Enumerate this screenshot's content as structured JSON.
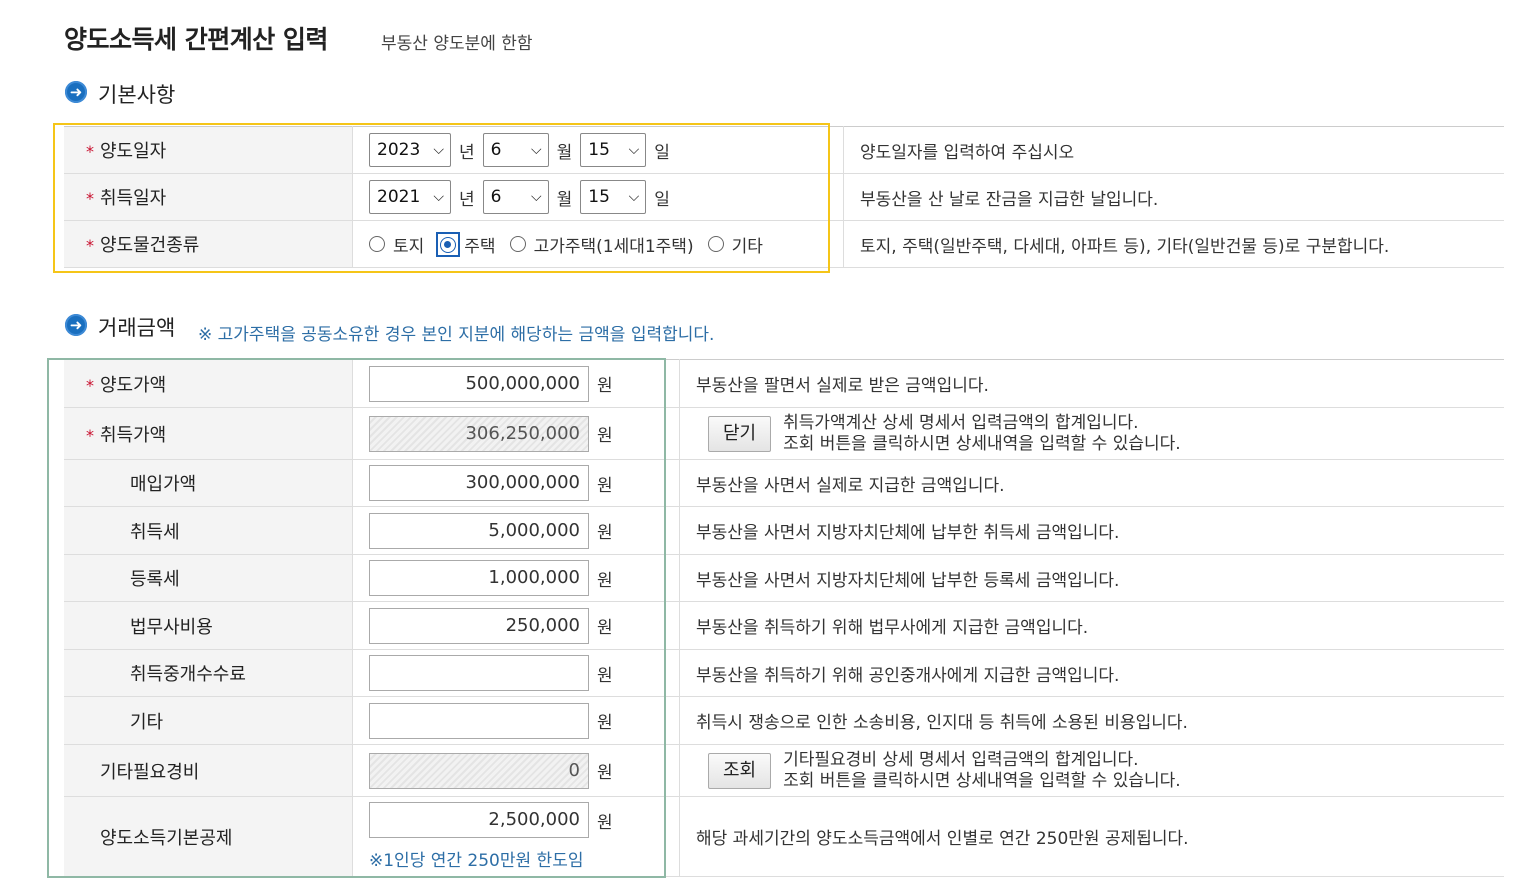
{
  "header": {
    "title": "양도소득세 간편계산 입력",
    "subtitle": "부동산 양도분에 한함"
  },
  "basic": {
    "section_title": "기본사항",
    "year_unit": "년",
    "month_unit": "월",
    "day_unit": "일",
    "rows": {
      "transfer_date": {
        "label": "양도일자",
        "year": "2023",
        "month": "6",
        "day": "15",
        "desc": "양도일자를 입력하여 주십시오"
      },
      "acquire_date": {
        "label": "취득일자",
        "year": "2021",
        "month": "6",
        "day": "15",
        "desc": "부동산을 산 날로 잔금을 지급한 날입니다."
      },
      "property_type": {
        "label": "양도물건종류",
        "options": [
          "토지",
          "주택",
          "고가주택(1세대1주택)",
          "기타"
        ],
        "selected": "주택",
        "desc": "토지, 주택(일반주택, 다세대, 아파트 등), 기타(일반건물 등)로 구분합니다."
      }
    }
  },
  "amount": {
    "section_title": "거래금액",
    "note": "※ 고가주택을 공동소유한 경우 본인 지분에 해당하는 금액을 입력합니다.",
    "unit": "원",
    "rows": {
      "transfer_price": {
        "label": "양도가액",
        "value": "500,000,000",
        "desc": "부동산을 팔면서 실제로 받은 금액입니다."
      },
      "acquire_price": {
        "label": "취득가액",
        "value": "306,250,000",
        "button": "닫기",
        "desc_line1": "취득가액계산 상세 명세서 입력금액의 합계입니다.",
        "desc_line2": "조회 버튼을 클릭하시면 상세내역을 입력할 수 있습니다."
      },
      "purchase_price": {
        "label": "매입가액",
        "value": "300,000,000",
        "desc": "부동산을 사면서 실제로 지급한 금액입니다."
      },
      "acquisition_tax": {
        "label": "취득세",
        "value": "5,000,000",
        "desc": "부동산을 사면서 지방자치단체에 납부한 취득세 금액입니다."
      },
      "registration_tax": {
        "label": "등록세",
        "value": "1,000,000",
        "desc": "부동산을 사면서 지방자치단체에 납부한 등록세 금액입니다."
      },
      "legal_fee": {
        "label": "법무사비용",
        "value": "250,000",
        "desc": "부동산을 취득하기 위해 법무사에게 지급한 금액입니다."
      },
      "broker_fee": {
        "label": "취득중개수수료",
        "value": "",
        "desc": "부동산을 취득하기 위해 공인중개사에게 지급한 금액입니다."
      },
      "other": {
        "label": "기타",
        "value": "",
        "desc": "취득시 쟁송으로 인한 소송비용, 인지대 등 취득에 소용된 비용입니다."
      },
      "other_expense": {
        "label": "기타필요경비",
        "value": "0",
        "button": "조회",
        "desc_line1": "기타필요경비 상세 명세서 입력금액의 합계입니다.",
        "desc_line2": "조회 버튼을 클릭하시면 상세내역을 입력할 수 있습니다."
      },
      "basic_deduction": {
        "label": "양도소득기본공제",
        "value": "2,500,000",
        "hint": "※1인당 연간 250만원 한도임",
        "desc": "해당 과세기간의 양도소득금액에서 인별로 연간 250만원 공제됩니다."
      }
    }
  },
  "colors": {
    "accent_blue": "#1a6fbf",
    "required_star": "#c8102e",
    "highlight_yellow": "#f5c518",
    "highlight_green": "#8fb8a5"
  },
  "icons": {
    "section": "arrow-circle-icon",
    "select": "chevron-down-icon"
  }
}
